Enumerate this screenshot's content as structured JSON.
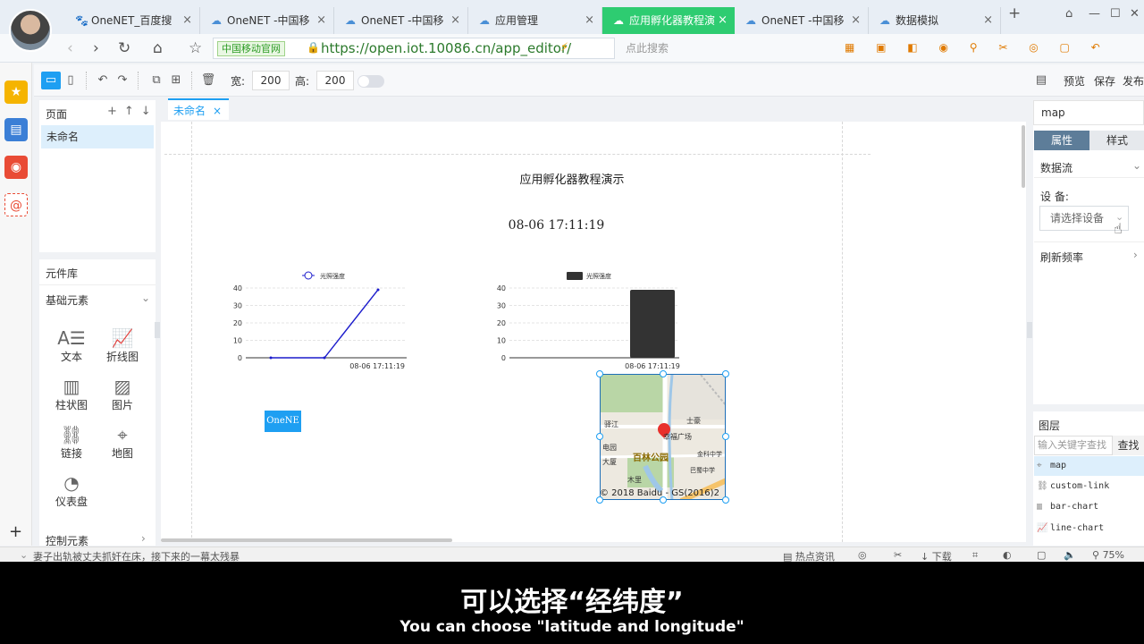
{
  "browser": {
    "tabs": [
      {
        "label": "OneNET_百度搜",
        "icon": "paw-icon"
      },
      {
        "label": "OneNET -中国移",
        "icon": "cloud-icon"
      },
      {
        "label": "OneNET -中国移",
        "icon": "cloud-icon"
      },
      {
        "label": "应用管理",
        "icon": "cloud-icon"
      },
      {
        "label": "应用孵化器教程演",
        "icon": "cloud-icon",
        "active": true
      },
      {
        "label": "OneNET -中国移",
        "icon": "cloud-icon"
      },
      {
        "label": "数据模拟",
        "icon": "cloud-icon"
      }
    ],
    "new_tab": "+",
    "site_badge": "中国移动官网",
    "url": "https://open.iot.10086.cn/app_editor/",
    "search_placeholder": "点此搜索",
    "accent": "#2ecc71"
  },
  "toolbar": {
    "width_label": "宽:",
    "width_value": "200",
    "height_label": "高:",
    "height_value": "200",
    "preview": "预览",
    "save": "保存",
    "publish": "发布"
  },
  "pages_panel": {
    "title": "页面",
    "items": [
      "未命名"
    ]
  },
  "library": {
    "title": "元件库",
    "section": "基础元素",
    "components": [
      {
        "label": "文本",
        "icon": "text-icon"
      },
      {
        "label": "折线图",
        "icon": "line-chart-icon"
      },
      {
        "label": "柱状图",
        "icon": "bar-chart-icon"
      },
      {
        "label": "图片",
        "icon": "image-icon"
      },
      {
        "label": "链接",
        "icon": "link-icon"
      },
      {
        "label": "地图",
        "icon": "map-pin-icon"
      },
      {
        "label": "仪表盘",
        "icon": "gauge-icon"
      }
    ],
    "section2": "控制元素"
  },
  "canvas": {
    "doc_tab": "未命名",
    "title": "应用孵化器教程演示",
    "time": "08-06 17:11:19",
    "button_label": "OneNE",
    "map_labels": [
      "百林公园",
      "幸福广场",
      "士豪",
      "电园",
      "大厦",
      "木里",
      "巴蜀中学",
      "金科中学",
      "驿江"
    ],
    "map_copyright": "© 2018 Baidu - GS(2016)2"
  },
  "chart_data": [
    {
      "type": "line",
      "legend": [
        "光照强度"
      ],
      "x_ticks": [
        "08-06 17:11:19"
      ],
      "y_ticks": [
        0,
        10,
        20,
        30,
        40
      ],
      "ylim": [
        0,
        40
      ],
      "series": [
        {
          "name": "光照强度",
          "values": [
            0,
            0,
            39
          ]
        }
      ],
      "color": "#1c1ccc"
    },
    {
      "type": "bar",
      "legend": [
        "光照强度"
      ],
      "categories": [
        "08-06 17:11:19"
      ],
      "y_ticks": [
        0,
        10,
        20,
        30,
        40
      ],
      "ylim": [
        0,
        40
      ],
      "series": [
        {
          "name": "光照强度",
          "values": [
            39
          ]
        }
      ],
      "color": "#333333"
    }
  ],
  "right_panel": {
    "component_name": "map",
    "tab_properties": "属性",
    "tab_style": "样式",
    "datastream": "数据流",
    "device_label": "设 备:",
    "device_placeholder": "请选择设备",
    "refresh": "刷新频率"
  },
  "layers": {
    "title": "图层",
    "search_placeholder": "输入关键字查找",
    "search_button": "查找",
    "items": [
      "map",
      "custom-link",
      "bar-chart",
      "line-chart"
    ]
  },
  "statusbar": {
    "news": "妻子出轨被丈夫抓奸在床，接下来的一幕太残暴",
    "hot": "热点资讯",
    "download": "下载",
    "zoom": "75%"
  },
  "subtitles": {
    "zh": "可以选择“经纬度”",
    "en": "You can choose \"latitude and longitude\""
  }
}
